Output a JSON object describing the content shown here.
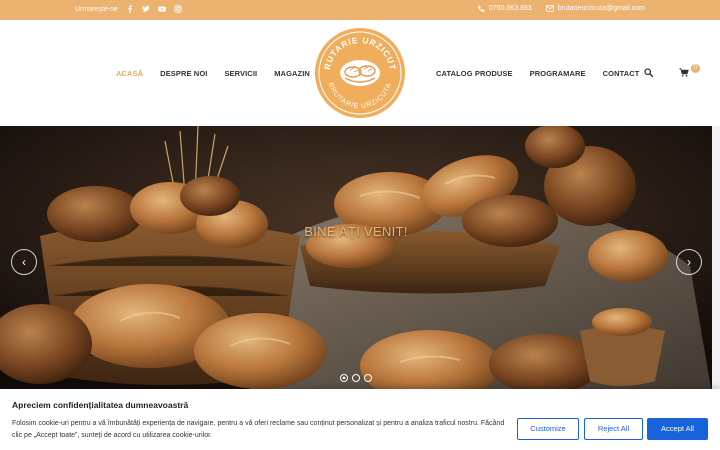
{
  "topbar": {
    "follow_label": "Urmarește-ne",
    "social": [
      "facebook-icon",
      "twitter-icon",
      "youtube-icon",
      "instagram-icon"
    ],
    "phone": "0760.063.883",
    "email": "brutarieurzicuta@gmail.com",
    "bg_color": "#ecb270"
  },
  "nav": {
    "left": [
      {
        "label": "ACASĂ",
        "active": true
      },
      {
        "label": "DESPRE NOI",
        "active": false
      },
      {
        "label": "SERVICII",
        "active": false
      },
      {
        "label": "MAGAZIN",
        "active": false
      }
    ],
    "right": [
      {
        "label": "CATALOG PRODUSE"
      },
      {
        "label": "PROGRAMARE"
      },
      {
        "label": "CONTACT"
      }
    ],
    "cart_count": "0",
    "accent_color": "#e8a860"
  },
  "logo": {
    "top_text": "BRUTARIE URZICUTA",
    "bottom_text": "BRUTARIE URZICUTA"
  },
  "hero": {
    "title": "BINE AȚI VENIT!",
    "prev_symbol": "‹",
    "next_symbol": "›",
    "slides": 3,
    "active_slide": 1
  },
  "cookie": {
    "title": "Apreciem confidențialitatea dumneavoastră",
    "text": "Folosim cookie-uri pentru a vă îmbunătăți experiența de navigare, pentru a vă oferi reclame sau conținut personalizat și pentru a analiza traficul nostru. Făcând clic pe „Accept toate”, sunteți de acord cu utilizarea cookie-urilor.",
    "customize_label": "Customize",
    "reject_label": "Reject All",
    "accept_label": "Accept All",
    "button_color": "#1863dc"
  }
}
